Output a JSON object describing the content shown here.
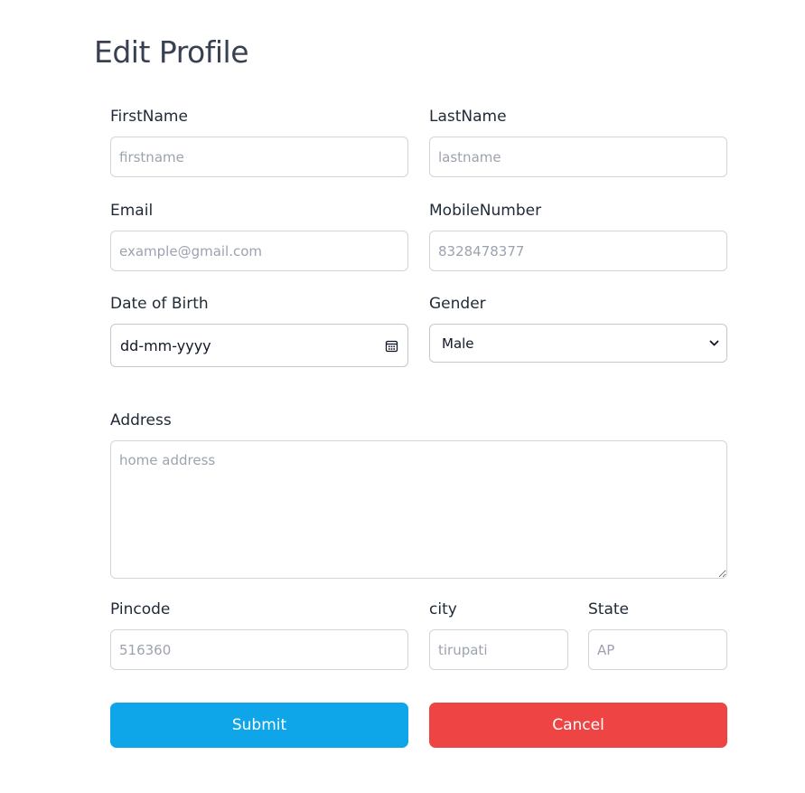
{
  "page": {
    "title": "Edit Profile"
  },
  "form": {
    "first_name": {
      "label": "FirstName",
      "value": "",
      "placeholder": "firstname"
    },
    "last_name": {
      "label": "LastName",
      "value": "",
      "placeholder": "lastname"
    },
    "email": {
      "label": "Email",
      "value": "",
      "placeholder": "example@gmail.com"
    },
    "mobile": {
      "label": "MobileNumber",
      "value": "",
      "placeholder": "8328478377"
    },
    "dob": {
      "label": "Date of Birth",
      "display": "dd-mm-yyyy",
      "icon": "calendar-icon"
    },
    "gender": {
      "label": "Gender",
      "selected": "Male",
      "icon": "chevron-down-icon"
    },
    "address": {
      "label": "Address",
      "value": "",
      "placeholder": "home address"
    },
    "pincode": {
      "label": "Pincode",
      "value": "",
      "placeholder": "516360"
    },
    "city": {
      "label": "city",
      "value": "",
      "placeholder": "tirupati"
    },
    "state": {
      "label": "State",
      "value": "",
      "placeholder": "AP"
    }
  },
  "actions": {
    "submit_label": "Submit",
    "cancel_label": "Cancel"
  },
  "colors": {
    "submit": "#0ea5e9",
    "cancel": "#ef4444",
    "border": "#d1d5db",
    "placeholder": "#9ca3af"
  }
}
